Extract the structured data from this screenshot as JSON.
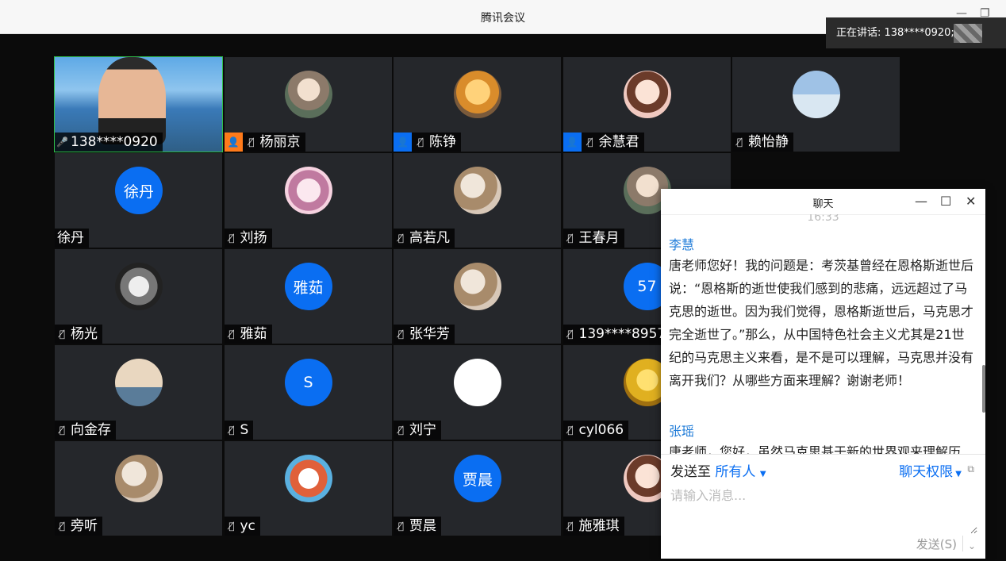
{
  "app": {
    "title": "腾讯会议",
    "speaking": "正在讲话: 138****0920;"
  },
  "tiles": [
    {
      "name": "138****0920",
      "type": "video",
      "mic": "on",
      "role": null
    },
    {
      "name": "杨丽京",
      "type": "photo",
      "avatar_style": "photo",
      "mic": "muted",
      "role": "orange"
    },
    {
      "name": "陈铮",
      "type": "photo",
      "avatar_style": "photo2",
      "mic": "muted",
      "role": "blue"
    },
    {
      "name": "余慧君",
      "type": "photo",
      "avatar_style": "photo3",
      "mic": "muted",
      "role": "blue"
    },
    {
      "name": "赖怡静",
      "type": "photo",
      "avatar_style": "photo10",
      "mic": "muted",
      "role": null
    },
    {
      "name": "徐丹",
      "type": "text",
      "avatar_text": "徐丹",
      "mic": "none",
      "role": null
    },
    {
      "name": "刘扬",
      "type": "photo",
      "avatar_style": "photo8",
      "mic": "muted",
      "role": null
    },
    {
      "name": "高若凡",
      "type": "photo",
      "avatar_style": "photo9",
      "mic": "muted",
      "role": null
    },
    {
      "name": "王春月",
      "type": "photo",
      "avatar_style": "photo",
      "mic": "muted",
      "role": null
    },
    {
      "name": "",
      "type": "hidden",
      "mic": "none",
      "role": null
    },
    {
      "name": "杨光",
      "type": "photo",
      "avatar_style": "photo4",
      "mic": "muted",
      "role": null
    },
    {
      "name": "雅茹",
      "type": "text",
      "avatar_text": "雅茹",
      "mic": "muted",
      "role": null
    },
    {
      "name": "张华芳",
      "type": "photo",
      "avatar_style": "photo9",
      "mic": "muted",
      "role": null
    },
    {
      "name": "139****8957",
      "type": "text",
      "avatar_text": "57",
      "mic": "muted",
      "role": null
    },
    {
      "name": "",
      "type": "hidden",
      "mic": "none",
      "role": null
    },
    {
      "name": "向金存",
      "type": "photo",
      "avatar_style": "photo5",
      "mic": "muted",
      "role": null
    },
    {
      "name": "S",
      "type": "text",
      "avatar_text": "S",
      "mic": "muted",
      "role": null
    },
    {
      "name": "刘宁",
      "type": "white",
      "mic": "muted",
      "role": null
    },
    {
      "name": "cyl066",
      "type": "photo",
      "avatar_style": "photo6",
      "mic": "muted",
      "role": null
    },
    {
      "name": "",
      "type": "hidden",
      "mic": "none",
      "role": null
    },
    {
      "name": "旁听",
      "type": "photo",
      "avatar_style": "photo9",
      "mic": "muted",
      "role": null
    },
    {
      "name": "yc",
      "type": "photo",
      "avatar_style": "photo7",
      "mic": "muted",
      "role": null
    },
    {
      "name": "贾晨",
      "type": "text",
      "avatar_text": "贾晨",
      "mic": "muted",
      "role": null
    },
    {
      "name": "施雅琪",
      "type": "photo",
      "avatar_style": "photo3",
      "mic": "muted",
      "role": null
    },
    {
      "name": "",
      "type": "hidden",
      "mic": "none",
      "role": null
    }
  ],
  "chat": {
    "title": "聊天",
    "time": "16:33",
    "messages": [
      {
        "sender": "李慧",
        "text": "唐老师您好！我的问题是：考茨基曾经在恩格斯逝世后说：“恩格斯的逝世使我们感到的悲痛，远远超过了马克思的逝世。因为我们觉得，恩格斯逝世后，马克思才完全逝世了。”那么，从中国特色社会主义尤其是21世纪的马克思主义来看，是不是可以理解，马克思并没有离开我们？从哪些方面来理解？谢谢老师！"
      },
      {
        "sender": "张瑶",
        "text": "唐老师，您好，虽然马克思基于新的世界观来理解历"
      }
    ],
    "send_to_label": "发送至",
    "send_to_value": "所有人",
    "permission_label": "聊天权限",
    "input_placeholder": "请输入消息...",
    "send_label": "发送(S)"
  },
  "colors": {
    "accent": "#0a6ef2",
    "active_border": "#2fbf4a",
    "orange": "#ff7a1a"
  }
}
